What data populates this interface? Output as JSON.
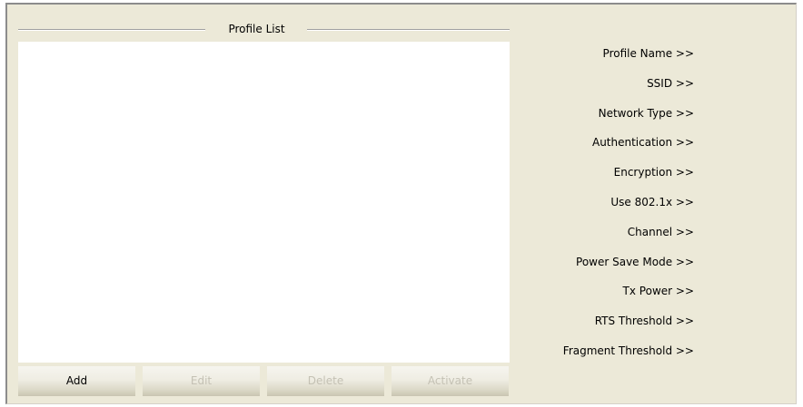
{
  "profile_list": {
    "title": "Profile List",
    "items": []
  },
  "buttons": {
    "add": "Add",
    "edit": "Edit",
    "delete": "Delete",
    "activate": "Activate"
  },
  "properties": [
    "Profile Name >>",
    "SSID >>",
    "Network Type >>",
    "Authentication >>",
    "Encryption >>",
    "Use 802.1x >>",
    "Channel >>",
    "Power Save Mode >>",
    "Tx Power >>",
    "RTS Threshold >>",
    "Fragment Threshold >>"
  ]
}
